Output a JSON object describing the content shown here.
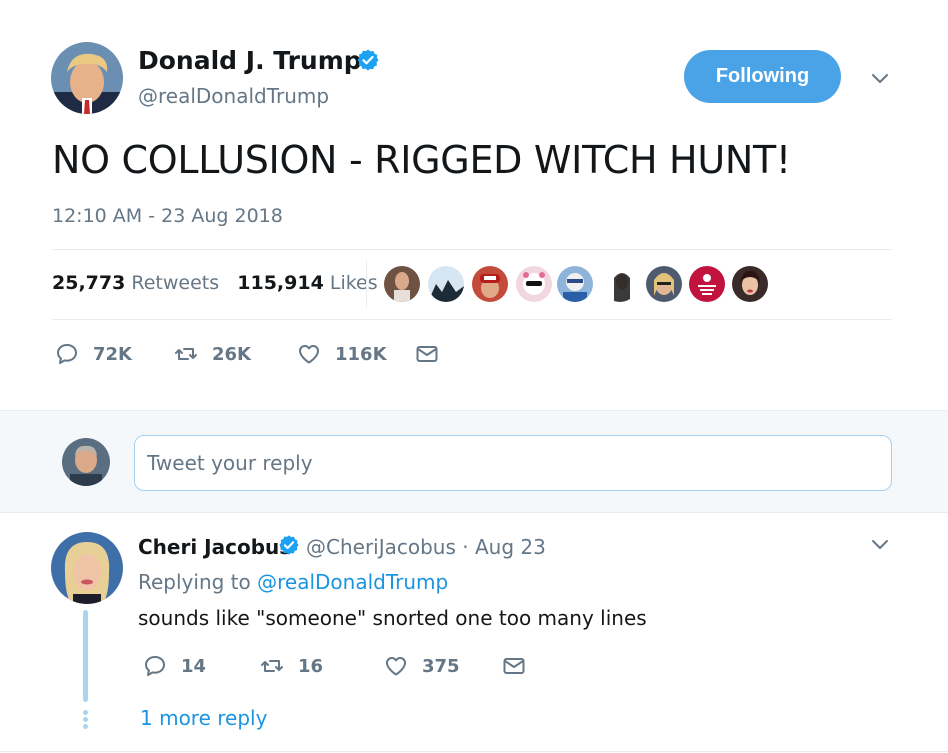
{
  "tweet": {
    "author_name": "Donald J. Trump",
    "author_handle": "@realDonaldTrump",
    "follow_label": "Following",
    "text": "NO COLLUSION - RIGGED WITCH HUNT!",
    "timestamp": "12:10 AM - 23 Aug 2018",
    "retweets_count": "25,773",
    "retweets_label": "Retweets",
    "likes_count": "115,914",
    "likes_label": "Likes",
    "actions": {
      "replies": "72K",
      "retweets": "26K",
      "likes": "116K"
    },
    "icons": {
      "verified": "verified-badge-icon",
      "menu": "chevron-down-icon",
      "reply": "reply-icon",
      "retweet": "retweet-icon",
      "like": "heart-icon",
      "dm": "envelope-icon"
    }
  },
  "reply_box": {
    "placeholder": "Tweet your reply"
  },
  "reply": {
    "author_name": "Cheri Jacobus",
    "meta": "@CheriJacobus · Aug 23",
    "replying_prefix": "Replying to",
    "replying_to": "@realDonaldTrump",
    "text": "sounds like \"someone\" snorted one too many lines",
    "actions": {
      "replies": "14",
      "retweets": "16",
      "likes": "375"
    },
    "more_reply": "1 more reply"
  },
  "colors": {
    "accent": "#1da1f2",
    "follow_button": "#4aa3e6",
    "link": "#1b95e0",
    "muted_text": "#657786",
    "thread_line": "#a8d4f2"
  }
}
